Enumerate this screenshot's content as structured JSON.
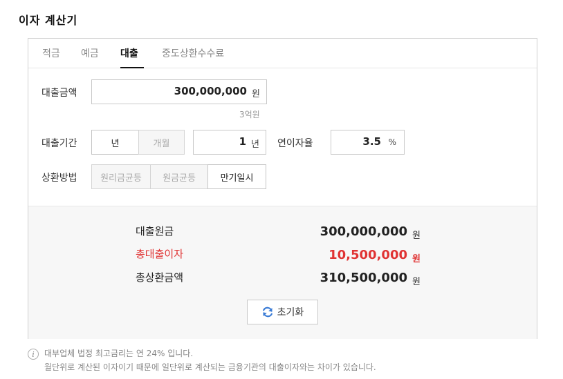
{
  "page": {
    "title": "이자 계산기"
  },
  "tabs": [
    {
      "label": "적금",
      "active": false
    },
    {
      "label": "예금",
      "active": false
    },
    {
      "label": "대출",
      "active": true
    },
    {
      "label": "중도상환수수료",
      "active": false
    }
  ],
  "loan_amount": {
    "label": "대출금액",
    "value": "300,000,000",
    "unit": "원",
    "hint": "3억원"
  },
  "loan_period": {
    "label": "대출기간",
    "unit_options": [
      {
        "label": "년",
        "selected": true
      },
      {
        "label": "개월",
        "selected": false
      }
    ],
    "value": "1",
    "unit": "년"
  },
  "interest_rate": {
    "label": "연이자율",
    "value": "3.5",
    "unit": "%"
  },
  "repayment": {
    "label": "상환방법",
    "options": [
      {
        "label": "원리금균등",
        "selected": false
      },
      {
        "label": "원금균등",
        "selected": false
      },
      {
        "label": "만기일시",
        "selected": true
      }
    ]
  },
  "results": [
    {
      "label": "대출원금",
      "value": "300,000,000",
      "unit": "원",
      "highlight": false
    },
    {
      "label": "총대출이자",
      "value": "10,500,000",
      "unit": "원",
      "highlight": true
    },
    {
      "label": "총상환금액",
      "value": "310,500,000",
      "unit": "원",
      "highlight": false
    }
  ],
  "reset": {
    "label": "초기화",
    "icon": "refresh-icon"
  },
  "notes": [
    "대부업체 법정 최고금리는 연 24% 입니다.",
    "월단위로 계산된 이자이기 때문에 일단위로 계산되는 금융기관의 대출이자와는 차이가 있습니다."
  ],
  "colors": {
    "highlight": "#e03333",
    "accent_blue": "#3a7bd5"
  }
}
